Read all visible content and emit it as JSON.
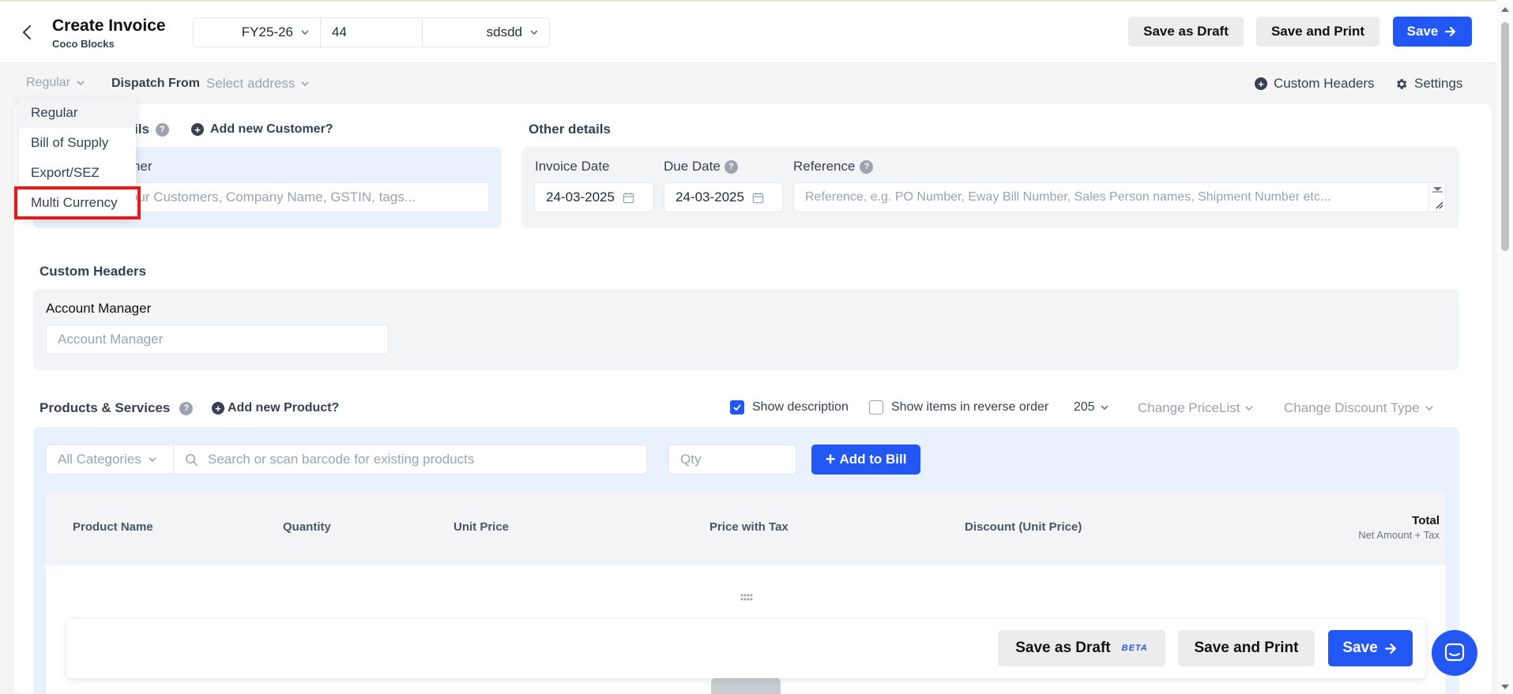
{
  "header": {
    "title": "Create Invoice",
    "subtitle": "Coco Blocks",
    "fy": "FY25-26",
    "number": "44",
    "prefix": "sdsdd",
    "save_draft": "Save as Draft",
    "save_print": "Save and Print",
    "save": "Save"
  },
  "subbar": {
    "invoice_type": "Regular",
    "dispatch_label": "Dispatch From",
    "dispatch_value": "Select address",
    "custom_headers": "Custom Headers",
    "settings": "Settings"
  },
  "type_menu": {
    "items": [
      "Regular",
      "Bill of Supply",
      "Export/SEZ",
      "Multi Currency"
    ]
  },
  "customer": {
    "section_label_partial": "ils",
    "add_new": "Add new Customer?",
    "field_label_partial": "ner",
    "search_placeholder_partial": "our Customers, Company Name, GSTIN, tags..."
  },
  "other_details": {
    "title": "Other details",
    "invoice_date_label": "Invoice Date",
    "invoice_date": "24-03-2025",
    "due_date_label": "Due Date",
    "due_date": "24-03-2025",
    "reference_label": "Reference",
    "reference_placeholder": "Reference, e.g. PO Number, Eway Bill Number, Sales Person names, Shipment Number etc..."
  },
  "custom_headers": {
    "title": "Custom Headers",
    "field_label": "Account Manager",
    "field_placeholder": "Account Manager"
  },
  "products": {
    "title": "Products & Services",
    "add_new": "Add new Product?",
    "show_description": "Show description",
    "show_reverse": "Show items in reverse order",
    "pricelist_num": "205",
    "change_pricelist": "Change PriceList",
    "change_discount": "Change Discount Type",
    "categories": "All Categories",
    "search_placeholder": "Search or scan barcode for existing products",
    "qty_placeholder": "Qty",
    "add_to_bill": "Add to Bill",
    "columns": {
      "name": "Product Name",
      "qty": "Quantity",
      "unit_price": "Unit Price",
      "price_tax": "Price with Tax",
      "discount": "Discount (Unit Price)",
      "total": "Total",
      "total_sub": "Net Amount + Tax"
    }
  },
  "footer": {
    "save_draft": "Save as Draft",
    "beta": "BETA",
    "save_print": "Save and Print",
    "save": "Save"
  },
  "colors": {
    "accent": "#2357f5",
    "highlight": "#e31b1b",
    "panel_blue": "#e8f1fd"
  }
}
